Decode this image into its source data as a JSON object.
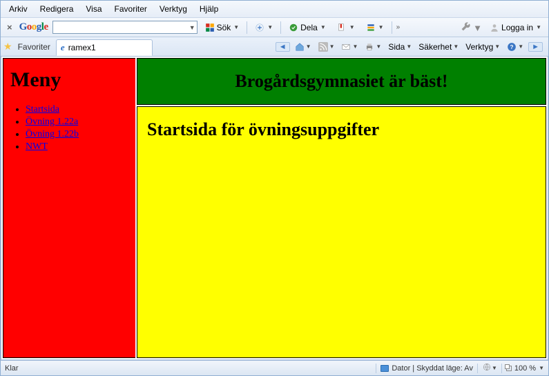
{
  "menubar": [
    "Arkiv",
    "Redigera",
    "Visa",
    "Favoriter",
    "Verktyg",
    "Hjälp"
  ],
  "google": {
    "logo_letters": [
      "G",
      "o",
      "o",
      "g",
      "l",
      "e"
    ],
    "search_label": "Sök",
    "share_label": "Dela",
    "login_label": "Logga in"
  },
  "favbar": {
    "favorites_label": "Favoriter",
    "tab_title": "ramex1"
  },
  "toolstrip": {
    "page_label": "Sida",
    "security_label": "Säkerhet",
    "tools_label": "Verktyg"
  },
  "frames": {
    "menu_heading": "Meny",
    "menu_items": [
      "Startsida",
      "Övning 1.22a",
      "Övning 1.22b",
      "NWT"
    ],
    "banner": "Brogårdsgymnasiet är bäst!",
    "main_heading": "Startsida för övningsuppgifter"
  },
  "status": {
    "ready": "Klar",
    "zone": "Dator | Skyddat läge: Av",
    "zoom": "100 %"
  }
}
